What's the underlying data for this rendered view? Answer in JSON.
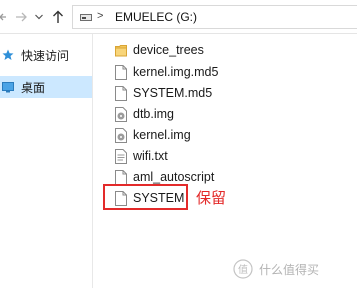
{
  "toolbar": {
    "back_icon": "arrow-left-icon",
    "forward_icon": "arrow-right-icon",
    "recent_icon": "chevron-down-icon",
    "up_icon": "arrow-up-icon"
  },
  "address_bar": {
    "drive_icon": "drive-icon",
    "separator": ">",
    "path": "EMUELEC (G:)"
  },
  "sidebar": {
    "items": [
      {
        "label": "快速访问",
        "icon": "star-icon",
        "selected": false
      },
      {
        "label": "桌面",
        "icon": "desktop-icon",
        "selected": true
      }
    ]
  },
  "files": [
    {
      "name": "device_trees",
      "type": "folder"
    },
    {
      "name": "kernel.img.md5",
      "type": "file"
    },
    {
      "name": "SYSTEM.md5",
      "type": "file"
    },
    {
      "name": "dtb.img",
      "type": "disk-image"
    },
    {
      "name": "kernel.img",
      "type": "disk-image"
    },
    {
      "name": "wifi.txt",
      "type": "text"
    },
    {
      "name": "aml_autoscript",
      "type": "file"
    },
    {
      "name": "SYSTEM",
      "type": "file"
    }
  ],
  "annotation": {
    "text": "保留",
    "color": "#e32a2a",
    "target": "SYSTEM"
  },
  "watermark": {
    "logo": "值",
    "text": "什么值得买"
  },
  "colors": {
    "selection": "#cce8ff",
    "folder": "#f3c75b",
    "annotation": "#e32a2a"
  }
}
